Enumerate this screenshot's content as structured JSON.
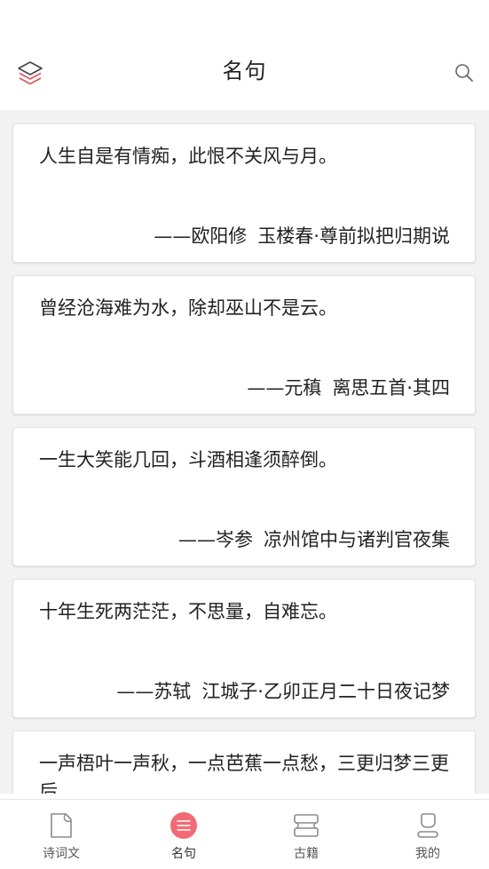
{
  "header": {
    "title": "名句"
  },
  "quotes": [
    {
      "text": "人生自是有情痴，此恨不关风与月。",
      "author": "——欧阳修",
      "work": "玉楼春·尊前拟把归期说"
    },
    {
      "text": "曾经沧海难为水，除却巫山不是云。",
      "author": "——元稹",
      "work": "离思五首·其四"
    },
    {
      "text": "一生大笑能几回，斗酒相逢须醉倒。",
      "author": "——岑参",
      "work": "凉州馆中与诸判官夜集"
    },
    {
      "text": "十年生死两茫茫，不思量，自难忘。",
      "author": "——苏轼",
      "work": "江城子·乙卯正月二十日夜记梦"
    },
    {
      "text": "一声梧叶一声秋，一点芭蕉一点愁，三更归梦三更后",
      "author": "",
      "work": ""
    }
  ],
  "bottom_nav": [
    {
      "label": "诗词文",
      "icon": "document-icon",
      "active": false
    },
    {
      "label": "名句",
      "icon": "list-circle-icon",
      "active": true
    },
    {
      "label": "古籍",
      "icon": "books-icon",
      "active": false
    },
    {
      "label": "我的",
      "icon": "person-icon",
      "active": false
    }
  ],
  "colors": {
    "accent": "#f26b74",
    "icon_gray": "#8a8a8a",
    "list_background": "#f2f2f2"
  }
}
